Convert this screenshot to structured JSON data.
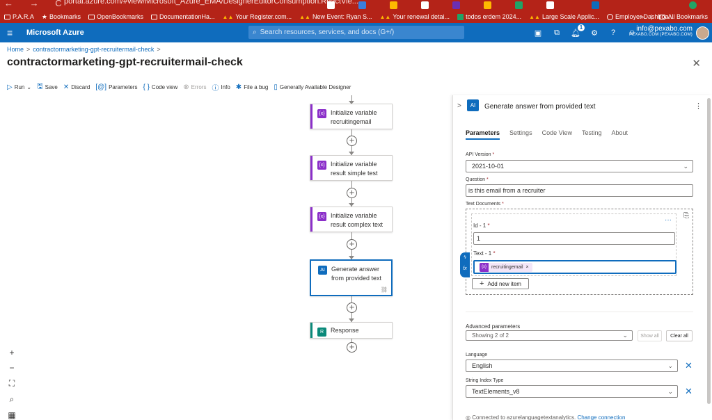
{
  "browser": {
    "url": "portal.azure.com/#view/Microsoft_Azure_EMA/DesignerEditorConsumption.ReactVie...",
    "bookmarks": [
      {
        "label": "P.A.R.A",
        "icon": "folder-icon"
      },
      {
        "label": "Bookmarks",
        "icon": "star-icon"
      },
      {
        "label": "OpenBookmarks",
        "icon": "folder-icon"
      },
      {
        "label": "DocumentationHa...",
        "icon": "folder-icon"
      },
      {
        "label": "Your Register.com...",
        "icon": "monday-icon"
      },
      {
        "label": "New Event: Ryan S...",
        "icon": "monday-icon"
      },
      {
        "label": "Your renewal detai...",
        "icon": "monday-icon"
      },
      {
        "label": "todos erdem 2024...",
        "icon": "sheets-icon"
      },
      {
        "label": "Large Scale Applic...",
        "icon": "monday-icon"
      },
      {
        "label": "Employer Dashboa...",
        "icon": "globe-icon"
      }
    ],
    "overflow": "»",
    "all_bookmarks": "All Bookmarks"
  },
  "azure": {
    "brand": "Microsoft Azure",
    "search_placeholder": "Search resources, services, and docs (G+/)",
    "notification_count": "1",
    "account_email": "info@pexabo.com",
    "account_tenant": "PEXABO.COM (PEXABO.COM)"
  },
  "breadcrumb": {
    "home": "Home",
    "current": "contractormarketing-gpt-recruitermail-check",
    "separator": ">"
  },
  "page": {
    "title": "contractormarketing-gpt-recruitermail-check",
    "more": "···"
  },
  "toolbar": {
    "run": "Run",
    "save": "Save",
    "discard": "Discard",
    "parameters": "Parameters",
    "code_view": "Code view",
    "errors": "Errors",
    "info": "Info",
    "file_bug": "File a bug",
    "ga_designer": "Generally Available Designer"
  },
  "workflow": {
    "steps": [
      {
        "label": "Initialize variable recruitingemail",
        "icon": "{x}",
        "color": "#8b2fc9"
      },
      {
        "label": "Initialize variable result simple test",
        "icon": "{x}",
        "color": "#8b2fc9"
      },
      {
        "label": "Initialize variable result complex text",
        "icon": "{x}",
        "color": "#8b2fc9"
      },
      {
        "label": "Generate answer from provided text",
        "icon": "AI",
        "color": "#0f6cbd"
      },
      {
        "label": "Response",
        "icon": "R",
        "color": "#0b8a7a"
      }
    ]
  },
  "panel": {
    "title": "Generate answer from provided text",
    "tabs": [
      "Parameters",
      "Settings",
      "Code View",
      "Testing",
      "About"
    ],
    "api_version_label": "API Version",
    "api_version_value": "2021-10-01",
    "question_label": "Question",
    "question_value": "is this email from a recruiter",
    "text_documents_label": "Text Documents",
    "id_label": "Id - 1",
    "id_value": "1",
    "text_label": "Text - 1",
    "token_label": "recruitingemail",
    "token_remove": "×",
    "add_new_item": "Add new item",
    "advanced_label": "Advanced parameters",
    "advanced_value": "Showing 2 of 2",
    "show_all": "Show all",
    "clear_all": "Clear all",
    "language_label": "Language",
    "language_value": "English",
    "string_index_label": "String Index Type",
    "string_index_value": "TextElements_v8",
    "connection_text": "Connected to azurelanguagetextanalytics.",
    "change_connection": "Change connection"
  },
  "colors": {
    "chrome_red": "#b42318",
    "azure_blue": "#0f6cbd",
    "variable_purple": "#8b2fc9",
    "response_teal": "#0b8a7a"
  }
}
